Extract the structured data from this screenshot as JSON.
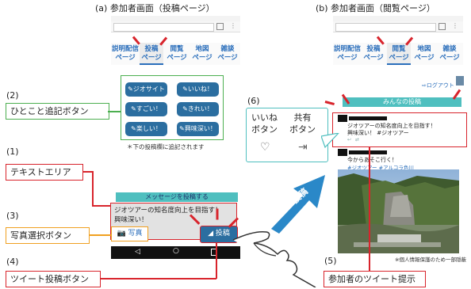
{
  "captions": {
    "post_page": "(a) 参加者画面（投稿ページ）",
    "view_page": "(b) 参加者画面（閲覧ページ）"
  },
  "post_phone": {
    "tabs": [
      "説明配信\nページ",
      "投稿\nページ",
      "閲覧\nページ",
      "地図\nページ",
      "雑談\nページ"
    ],
    "selected_tab": 1,
    "quick_buttons": [
      "ジオサイト",
      "いいね！",
      "すごい！",
      "きれい！",
      "楽しい！",
      "興味深い！"
    ],
    "note": "＊下の投稿欄に追記されます",
    "post_header": "メッセージを投稿する",
    "textarea_line1": "ジオツアーの知名度向上を目指す！",
    "textarea_line2": "興味深い！",
    "photo_button": "写真",
    "post_button": "投稿"
  },
  "view_phone": {
    "tabs": [
      "説明配信\nページ",
      "投稿\nページ",
      "閲覧\nページ",
      "地図\nページ",
      "雑談\nページ"
    ],
    "selected_tab": 2,
    "logout": "ログアウト",
    "feed_header": "みんなの投稿",
    "post1_line1": "ジオツアーの知名度向上を目指す！",
    "post1_line2": "興味深い！ #ジオツアー",
    "post2_line1": "今からあそこ行く！",
    "post2_line2": "#ジオツアー #アルコラ色川",
    "privacy_note": "※個人情報保護のため一部隠蔽"
  },
  "arrow_label": "投稿",
  "callouts": {
    "n1": "(1)",
    "l1": "テキストエリア",
    "n2": "(2)",
    "l2": "ひとこと追記ボタン",
    "n3": "(3)",
    "l3": "写真選択ボタン",
    "n4": "(4)",
    "l4": "ツイート投稿ボタン",
    "n5": "(5)",
    "l5": "参加者のツイート提示",
    "n6": "(6)",
    "l6a": "いいね",
    "l6b": "ボタン",
    "l6c": "共有",
    "l6d": "ボタン"
  },
  "colors": {
    "red": "#d8242c",
    "green": "#4caf50",
    "orange": "#f0a020",
    "blue": "#2a6ebb",
    "teal": "#4fbfbf",
    "dark_teal": "#3a7fa0",
    "button_blue": "#2b6ea0"
  }
}
